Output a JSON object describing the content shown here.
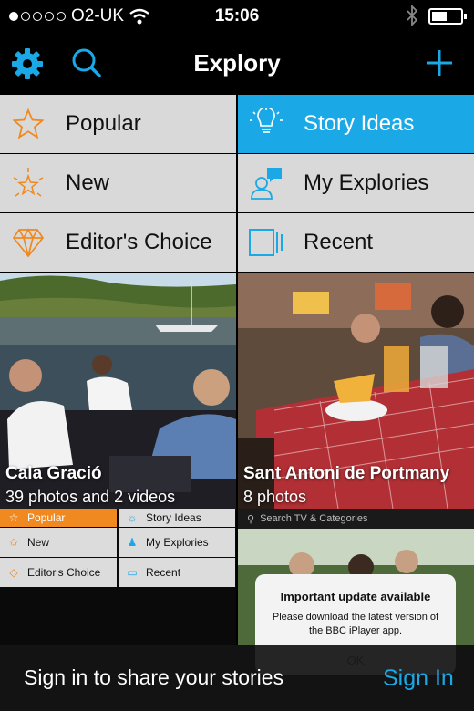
{
  "status_bar": {
    "carrier": "O2-UK",
    "time": "15:06"
  },
  "nav": {
    "title": "Explory"
  },
  "categories": [
    {
      "label": "Popular",
      "icon": "star-icon",
      "active": false
    },
    {
      "label": "Story Ideas",
      "icon": "lightbulb-icon",
      "active": true
    },
    {
      "label": "New",
      "icon": "sparkle-star-icon",
      "active": false
    },
    {
      "label": "My Explories",
      "icon": "person-chat-icon",
      "active": false
    },
    {
      "label": "Editor's Choice",
      "icon": "diamond-icon",
      "active": false
    },
    {
      "label": "Recent",
      "icon": "recent-frames-icon",
      "active": false
    }
  ],
  "stories": [
    {
      "name": "Cala Gració",
      "count": "39 photos and 2 videos"
    },
    {
      "name": "Sant Antoni de Portmany",
      "count": "8 photos"
    }
  ],
  "mini_preview": {
    "items": [
      "Popular",
      "Story Ideas",
      "New",
      "My Explories",
      "Editor's Choice",
      "Recent"
    ]
  },
  "bbc_preview": {
    "search_placeholder": "Search TV & Categories",
    "dialog_title": "Important update available",
    "dialog_message": "Please download the latest version of the BBC iPlayer app.",
    "dialog_button": "OK"
  },
  "sign_in": {
    "message": "Sign in to share your stories",
    "button": "Sign In"
  },
  "colors": {
    "accent": "#1aa9e6",
    "icon_orange": "#f0891f",
    "cell_bg": "#d9d9d9"
  }
}
